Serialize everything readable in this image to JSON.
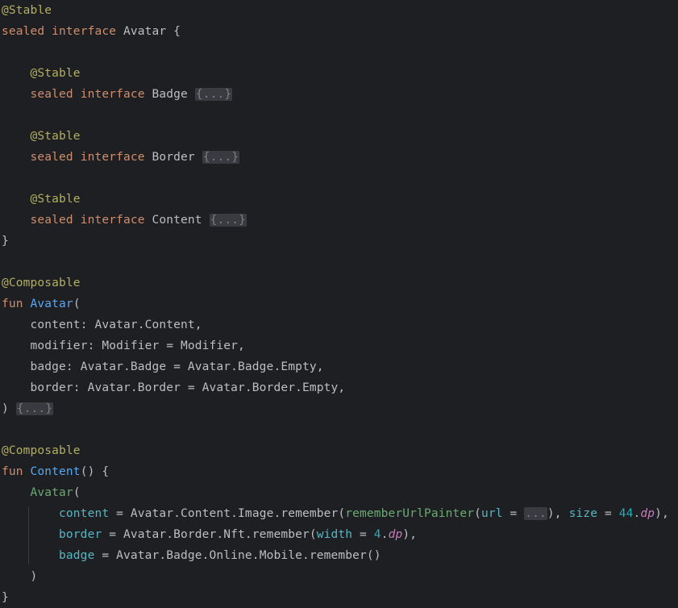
{
  "keywords": {
    "stable": "@Stable",
    "composable": "@Composable",
    "sealed": "sealed",
    "interface": "interface",
    "fun": "fun"
  },
  "punct": {
    "open_brace": "{",
    "close_brace": "}",
    "open_paren": "(",
    "close_paren": ")",
    "paren_close_fold": ") ",
    "fold": "{...}",
    "ellipsis": "..."
  },
  "avatar_interface": {
    "name": "Avatar"
  },
  "nested": [
    {
      "name": "Badge"
    },
    {
      "name": "Border"
    },
    {
      "name": "Content"
    }
  ],
  "avatar_fun": {
    "name": "Avatar",
    "params": [
      "content: Avatar.Content,",
      "modifier: Modifier = Modifier,",
      "badge: Avatar.Badge = Avatar.Badge.Empty,",
      "border: Avatar.Border = Avatar.Border.Empty,"
    ]
  },
  "content_fun": {
    "name": "Content",
    "sig_tail": "() {",
    "call": "Avatar",
    "line1": {
      "param": "content",
      "eq": " = ",
      "expr": "Avatar.Content.Image.remember(",
      "lambda": "rememberUrlPainter",
      "open": "(",
      "url_param": "url",
      "eq2": " = ",
      "url_val": "...",
      "close": "), ",
      "size_param": "size",
      "eq3": " = ",
      "size_num": "44",
      "dot": ".",
      "dp": "dp",
      "end": "),"
    },
    "line2": {
      "param": "border",
      "eq": " = ",
      "expr": "Avatar.Border.Nft.remember(",
      "width_param": "width",
      "eq2": " = ",
      "width_num": "4",
      "dot": ".",
      "dp": "dp",
      "end": "),"
    },
    "line3": {
      "param": "badge",
      "eq": " = ",
      "expr": "Avatar.Badge.Online.Mobile.remember()"
    }
  }
}
